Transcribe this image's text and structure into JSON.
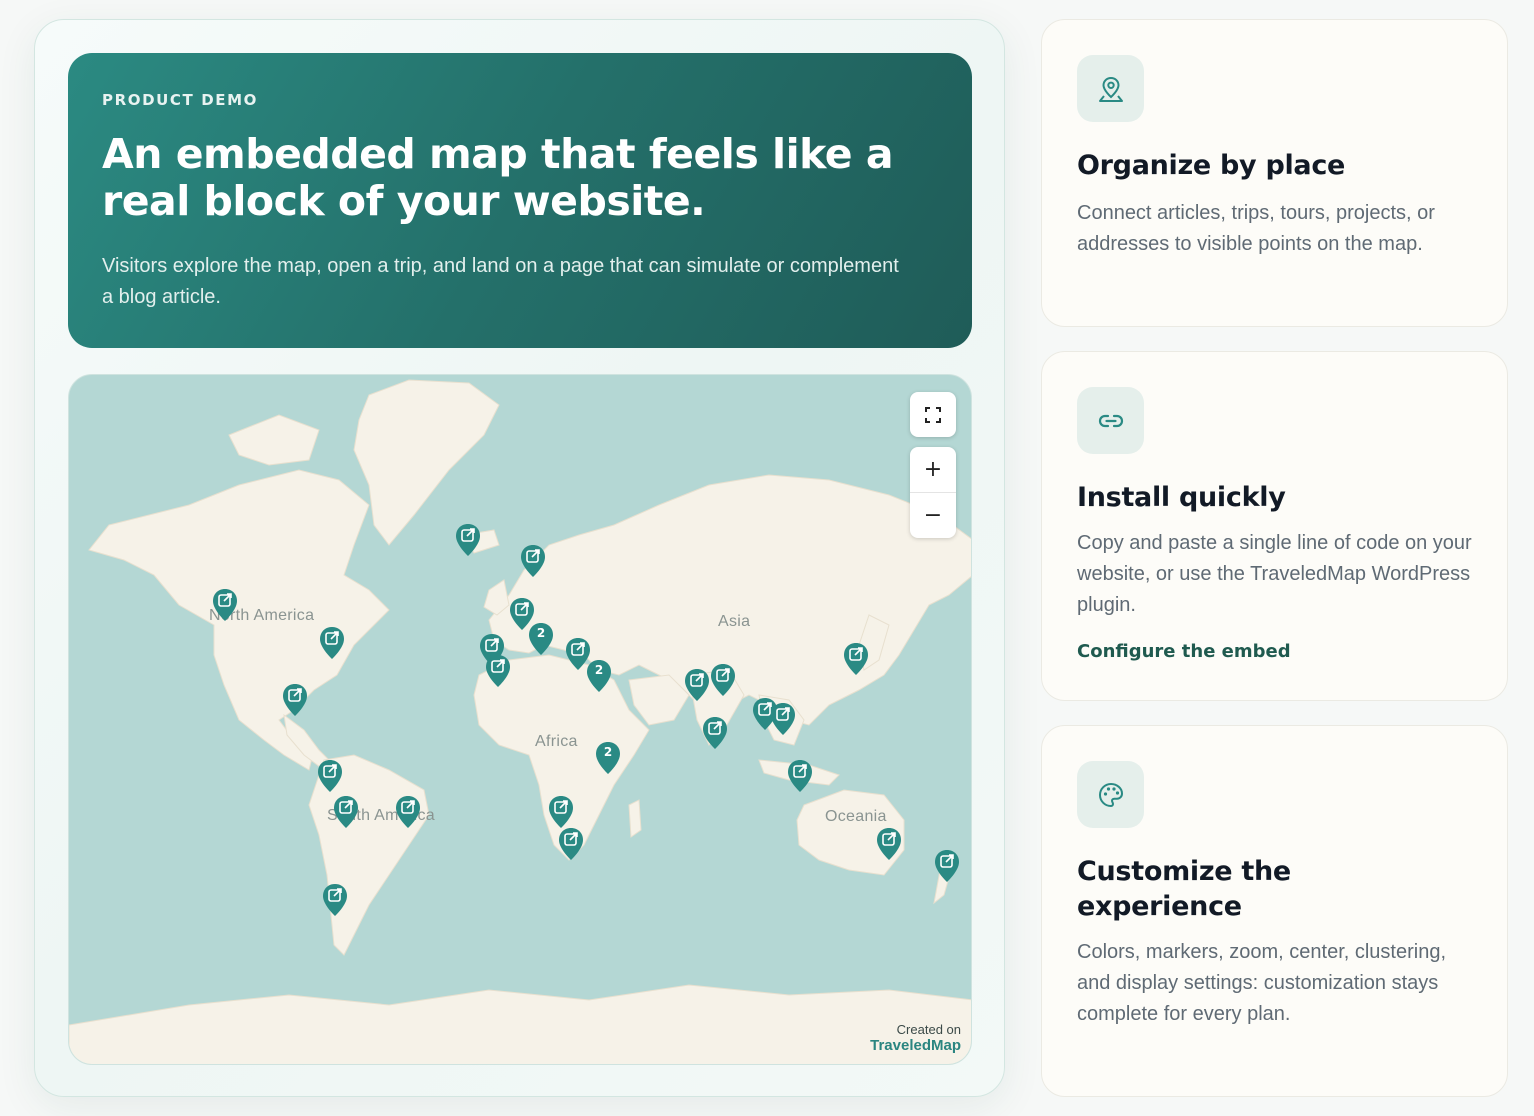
{
  "hero": {
    "eyebrow": "PRODUCT DEMO",
    "title": "An embedded map that feels like a real block of your website.",
    "description": "Visitors explore the map, open a trip, and land on a page that can simulate or complement a blog article."
  },
  "map": {
    "continents": [
      "North America",
      "South America",
      "Africa",
      "Asia",
      "Oceania"
    ],
    "controls": {
      "zoom_in": "+",
      "zoom_out": "−"
    },
    "cluster_count": "2",
    "attribution": {
      "line1": "Created on",
      "line2": "TraveledMap"
    },
    "marker_color": "#2a8a84"
  },
  "features": [
    {
      "icon": "map-pin-icon",
      "title": "Organize by place",
      "description": "Connect articles, trips, tours, projects, or addresses to visible points on the map."
    },
    {
      "icon": "link-icon",
      "title": "Install quickly",
      "description": "Copy and paste a single line of code on your website, or use the TraveledMap WordPress plugin.",
      "link": "Configure the embed"
    },
    {
      "icon": "palette-icon",
      "title": "Customize the experience",
      "description": "Colors, markers, zoom, center, clustering, and display settings: customization stays complete for every plan."
    }
  ],
  "colors": {
    "hero_start": "#2b8a82",
    "hero_end": "#1f5c58",
    "water": "#b4d7d4",
    "land": "#f6f2e8",
    "accent": "#1f5a4f"
  }
}
